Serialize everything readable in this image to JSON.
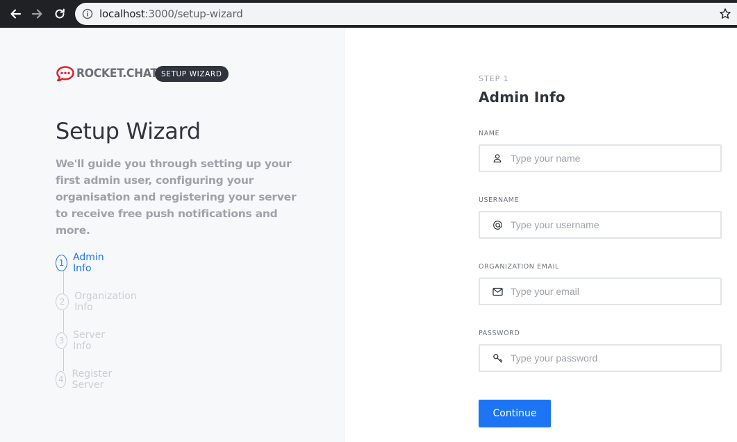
{
  "browser": {
    "url_host": "localhost",
    "url_path": ":3000/setup-wizard"
  },
  "brand": {
    "name": "ROCKET.CHAT",
    "badge": "SETUP WIZARD"
  },
  "intro": {
    "title": "Setup Wizard",
    "description": "We'll guide you through setting up your first admin user, configuring your organisation and registering your server to receive free push notifications and more."
  },
  "steps": [
    {
      "number": "1",
      "label": "Admin Info",
      "active": true
    },
    {
      "number": "2",
      "label": "Organization Info",
      "active": false
    },
    {
      "number": "3",
      "label": "Server Info",
      "active": false
    },
    {
      "number": "4",
      "label": "Register Server",
      "active": false
    }
  ],
  "form": {
    "step_caption": "STEP 1",
    "title": "Admin Info",
    "fields": [
      {
        "label": "NAME",
        "placeholder": "Type your name",
        "icon": "user-icon"
      },
      {
        "label": "USERNAME",
        "placeholder": "Type your username",
        "icon": "at-icon"
      },
      {
        "label": "ORGANIZATION EMAIL",
        "placeholder": "Type your email",
        "icon": "mail-icon"
      },
      {
        "label": "PASSWORD",
        "placeholder": "Type your password",
        "icon": "key-icon"
      }
    ],
    "submit_label": "Continue"
  },
  "colors": {
    "accent": "#1d74f5",
    "brand_red": "#e0242e",
    "dark": "#2f343d"
  }
}
